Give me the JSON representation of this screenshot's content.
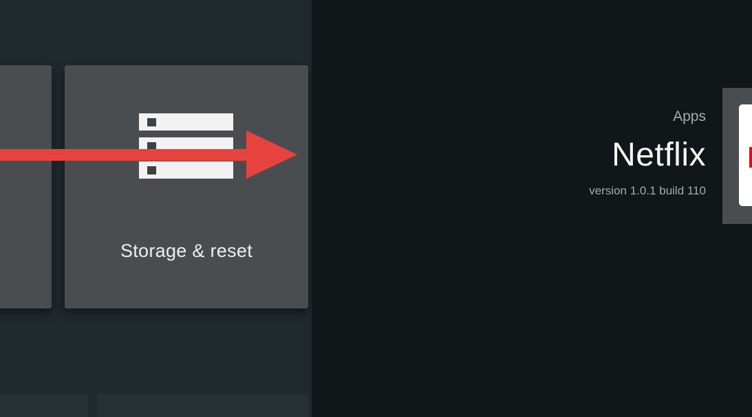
{
  "settings": {
    "tiles": [
      {
        "label": ""
      },
      {
        "label": "Storage & reset",
        "icon": "storage-icon"
      }
    ]
  },
  "app_info": {
    "category": "Apps",
    "name": "Netflix",
    "version": "version 1.0.1 build 110",
    "icon": "netflix-icon",
    "icon_color": "#e50914"
  },
  "annotation": {
    "arrow_color": "#e8423f"
  },
  "colors": {
    "left_background": "#1f292e",
    "right_background": "#111619",
    "tile": "#4a4d50"
  }
}
